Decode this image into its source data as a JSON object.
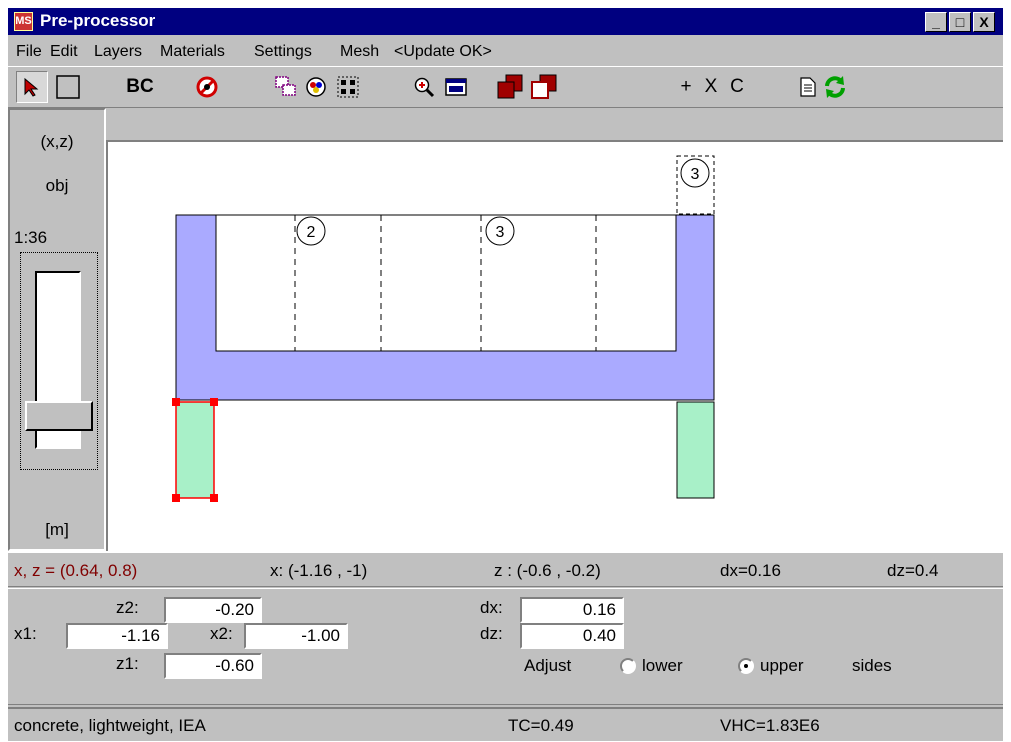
{
  "window": {
    "title": "Pre-processor",
    "icon_text": "MS",
    "controls": [
      "_",
      "□",
      "X"
    ]
  },
  "menubar": {
    "items": [
      "File",
      "Edit",
      "Layers",
      "Materials",
      "Settings",
      "Mesh",
      "<Update OK>"
    ]
  },
  "toolbar": {
    "bc_label": "BC",
    "add_label": "+",
    "x_label": "X",
    "c_label": "C",
    "icons": [
      "arrow-select-icon",
      "rectangle-icon",
      "no-entry-icon",
      "layers-select-icon",
      "materials-icon",
      "grid-points-icon",
      "zoom-in-icon",
      "fit-view-icon",
      "bring-front-icon",
      "send-back-icon",
      "document-icon",
      "refresh-icon"
    ]
  },
  "left_panel": {
    "coords": "(x,z)",
    "mode": "obj",
    "scale": "1:36",
    "unit": "[m]",
    "zoom_slider_level": 0.88
  },
  "canvas": {
    "labels": [
      "2",
      "3",
      "3"
    ],
    "colors": {
      "concrete_blue": "#aaaaff",
      "green_fill": "#a8f0c8",
      "selection_red": "#ff0000"
    }
  },
  "status_coords": {
    "cursor": "x, z = (0.64,  0.8)",
    "x_range": "x:  (-1.16 ,  -1)",
    "z_range": "z :  (-0.6 ,  -0.2)",
    "dx": "dx=0.16",
    "dz": "dz=0.4",
    "cursor_color": "#800000"
  },
  "inputs": {
    "z2_label": "z2:",
    "z2": "-0.20",
    "x1_label": "x1:",
    "x1": "-1.16",
    "x2_label": "x2:",
    "x2": "-1.00",
    "z1_label": "z1:",
    "z1": "-0.60",
    "dx_label": "dx:",
    "dx": "0.16",
    "dz_label": "dz:",
    "dz": "0.40",
    "adjust_label": "Adjust",
    "lower_label": "lower",
    "upper_label": "upper",
    "sides_label": "sides",
    "selected": "upper"
  },
  "material_status": {
    "material": "concrete, lightweight, IEA",
    "tc": "TC=0.49",
    "vhc": "VHC=1.83E6"
  }
}
